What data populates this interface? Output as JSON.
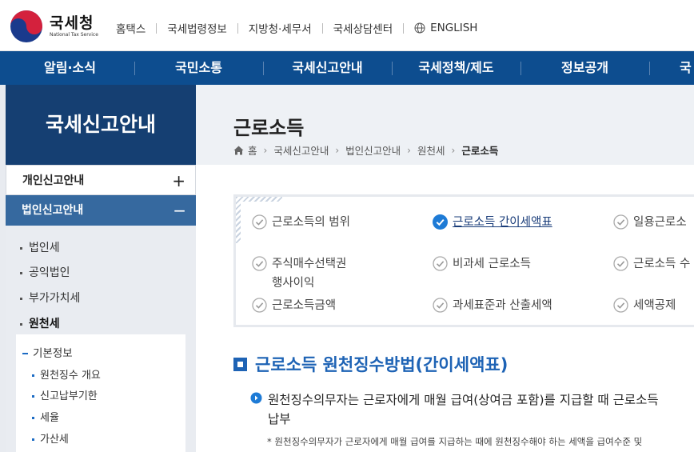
{
  "brand": {
    "name_ko": "국세청",
    "name_en": "National Tax Service"
  },
  "utility_links": [
    "홈택스",
    "국세법령정보",
    "지방청·세무서",
    "국세상담센터",
    "ENGLISH"
  ],
  "gnb": [
    "알림·소식",
    "국민소통",
    "국세신고안내",
    "국세정책/제도",
    "정보공개",
    "국"
  ],
  "sidebar": {
    "title": "국세신고안내",
    "menus": [
      {
        "label": "개인신고안내",
        "toggle": "+"
      },
      {
        "label": "법인신고안내",
        "toggle": "−"
      }
    ],
    "sub_items": [
      "법인세",
      "공익법인",
      "부가가치세",
      "원천세"
    ],
    "inner_head": "기본정보",
    "inner_items": [
      "원천징수 개요",
      "신고납부기한",
      "세율",
      "가산세"
    ]
  },
  "page": {
    "title": "근로소득",
    "breadcrumb": [
      "홈",
      "국세신고안내",
      "법인신고안내",
      "원천세",
      "근로소득"
    ]
  },
  "tabs": [
    {
      "label": "근로소득의 범위",
      "active": false
    },
    {
      "label": "근로소득 간이세액표",
      "active": true
    },
    {
      "label": "일용근로소",
      "active": false
    },
    {
      "label": "주식매수선택권",
      "label2": "행사이익",
      "active": false
    },
    {
      "label": "비과세 근로소득",
      "active": false
    },
    {
      "label": "근로소득 수",
      "active": false
    },
    {
      "label": "근로소득금액",
      "active": false
    },
    {
      "label": "과세표준과 산출세액",
      "active": false
    },
    {
      "label": "세액공제",
      "active": false
    }
  ],
  "section": {
    "title": "근로소득 원천징수방법(간이세액표)",
    "para_line1": "원천징수의무자는 근로자에게 매월 급여(상여금 포함)를 지급할 때 근로소득",
    "para_line2": "납부",
    "note": "* 원천징수의무자가 근로자에게 매월 급여를 지급하는 때에 원천징수해야 하는 세액을 급여수준 및"
  },
  "colors": {
    "gnb": "#0d4d8f",
    "sidebar_title": "#153f72",
    "active_menu": "#36699f",
    "accent": "#1e63b5"
  }
}
